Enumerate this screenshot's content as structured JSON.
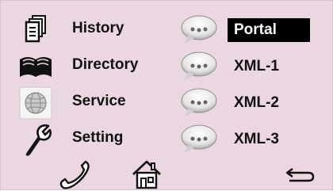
{
  "menu": {
    "left": [
      {
        "label": "History",
        "icon": "document-list-icon"
      },
      {
        "label": "Directory",
        "icon": "open-book-icon"
      },
      {
        "label": "Service",
        "icon": "globe-icon"
      },
      {
        "label": "Setting",
        "icon": "wrench-icon"
      }
    ],
    "right": [
      {
        "label": "Portal",
        "selected": true
      },
      {
        "label": "XML-1",
        "selected": false
      },
      {
        "label": "XML-2",
        "selected": false
      },
      {
        "label": "XML-3",
        "selected": false
      }
    ]
  },
  "softkeys": [
    "phone-handset-icon",
    "home-icon",
    "back-arrow-icon"
  ],
  "colors": {
    "background": "#ead7e1",
    "selected_bg": "#000000",
    "selected_text": "#ffffff",
    "text": "#111111"
  }
}
